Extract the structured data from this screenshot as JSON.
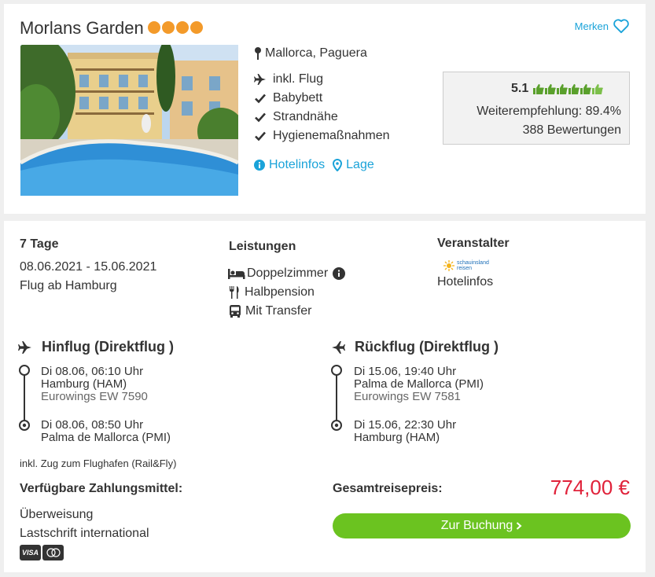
{
  "hotel": {
    "name": "Morlans Garden",
    "stars": 4,
    "merken_label": "Merken",
    "location": "Mallorca, Paguera",
    "features": [
      "inkl. Flug",
      "Babybett",
      "Strandnähe",
      "Hygienemaßnahmen"
    ],
    "links": {
      "hotelinfos": "Hotelinfos",
      "lage": "Lage"
    }
  },
  "rating": {
    "score": "5.1",
    "thumbs": 6,
    "recommendation": "Weiterempfehlung: 89.4%",
    "reviews": "388 Bewertungen"
  },
  "trip": {
    "duration": "7 Tage",
    "dates": "08.06.2021 - 15.06.2021",
    "departure": "Flug ab Hamburg"
  },
  "services": {
    "heading": "Leistungen",
    "items": [
      "Doppelzimmer",
      "Halbpension",
      "Mit Transfer"
    ]
  },
  "operator": {
    "heading": "Veranstalter",
    "logo_line1": "schauinsland",
    "logo_line2": "reisen",
    "link": "Hotelinfos"
  },
  "outbound": {
    "title": "Hinflug (Direktflug )",
    "dep_time": "Di 08.06, 06:10 Uhr",
    "dep_airport": "Hamburg (HAM)",
    "flight": "Eurowings EW 7590",
    "arr_time": "Di 08.06, 08:50 Uhr",
    "arr_airport": "Palma de Mallorca (PMI)"
  },
  "inbound": {
    "title": "Rückflug (Direktflug )",
    "dep_time": "Di 15.06, 19:40 Uhr",
    "dep_airport": "Palma de Mallorca (PMI)",
    "flight": "Eurowings EW 7581",
    "arr_time": "Di 15.06, 22:30 Uhr",
    "arr_airport": "Hamburg (HAM)"
  },
  "rail_note": "inkl. Zug zum Flughafen (Rail&Fly)",
  "payment": {
    "heading": "Verfügbare Zahlungsmittel:",
    "methods": [
      "Überweisung",
      "Lastschrift international"
    ],
    "card_visa": "VISA"
  },
  "total": {
    "label": "Gesamtreisepreis:",
    "price": "774,00 €",
    "button": "Zur Buchung"
  },
  "colors": {
    "accent": "#1aa3d9",
    "stars": "#f39a2a",
    "button": "#6bc320",
    "price": "#e0223a",
    "thumbs": "#5aa02c"
  }
}
